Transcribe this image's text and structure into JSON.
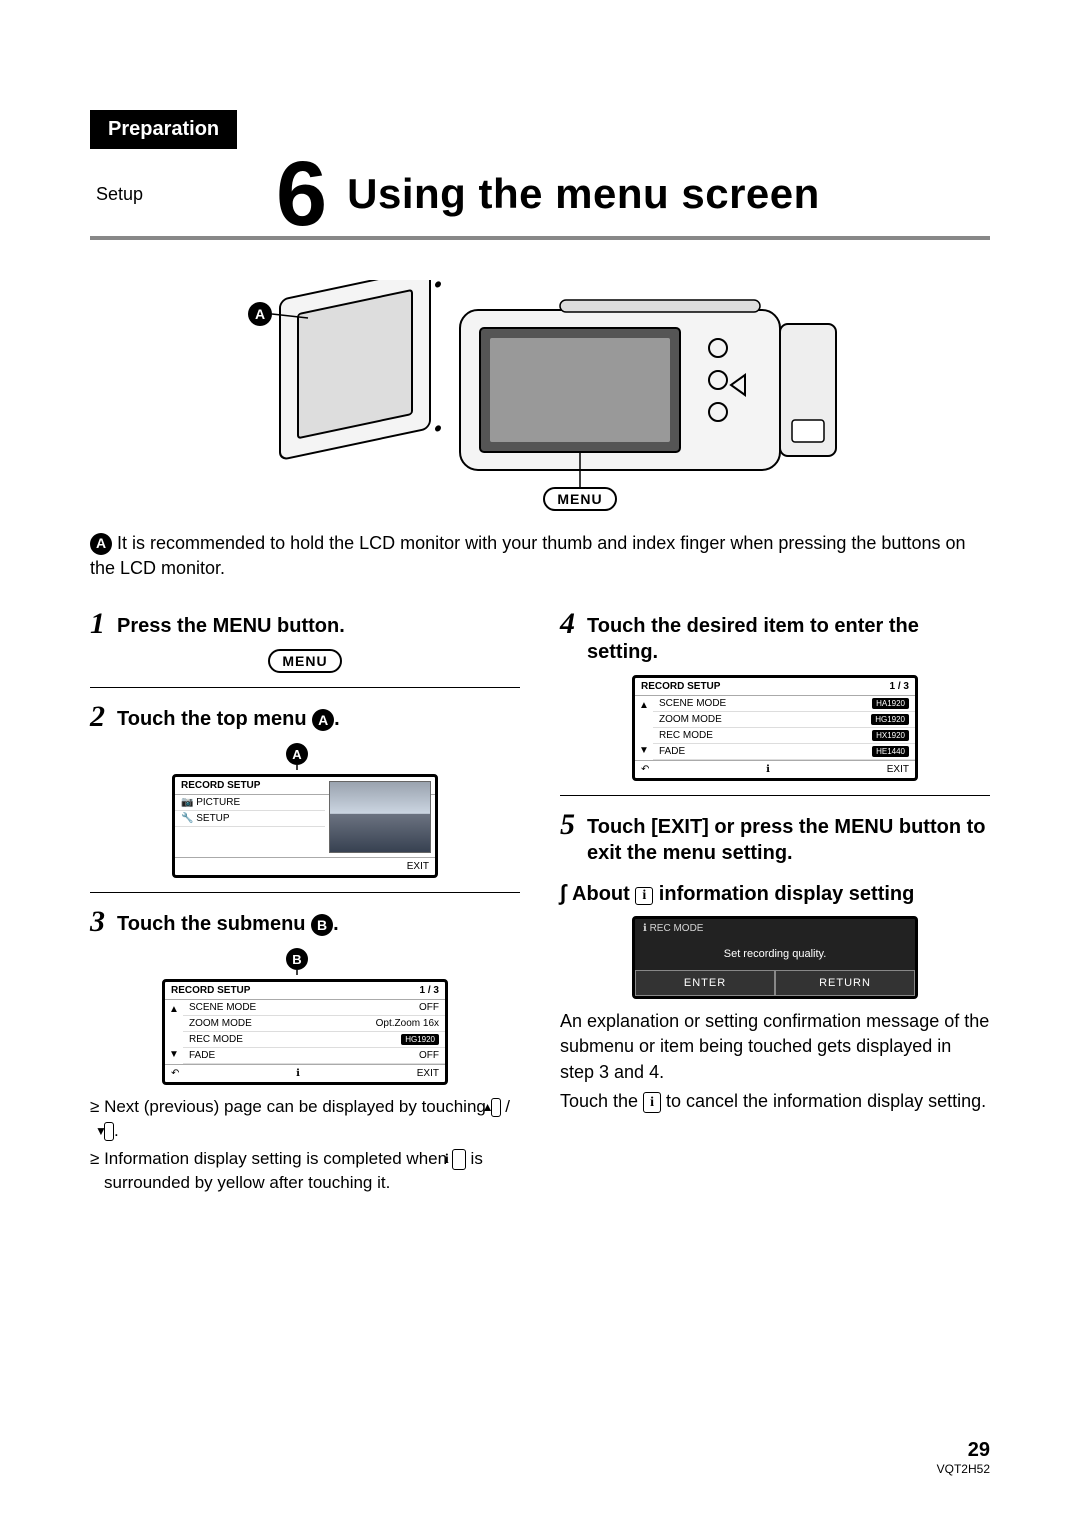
{
  "header": {
    "section": "Preparation",
    "subsection": "Setup",
    "number": "6",
    "title": "Using the menu screen"
  },
  "menu_label": "MENU",
  "callout": {
    "A": "A",
    "B": "B"
  },
  "intro_note": "It is recommended to hold the LCD monitor with your thumb and index finger when pressing the buttons on the LCD monitor.",
  "steps": {
    "s1": {
      "num": "1",
      "text": "Press the MENU button."
    },
    "s2": {
      "num": "2",
      "text_prefix": "Touch the top menu ",
      "text_suffix": "."
    },
    "s3": {
      "num": "3",
      "text_prefix": "Touch the submenu ",
      "text_suffix": "."
    },
    "s4": {
      "num": "4",
      "text": "Touch the desired item to enter the setting."
    },
    "s5": {
      "num": "5",
      "text": "Touch [EXIT] or press the MENU button to exit the menu setting."
    }
  },
  "lcd_top": {
    "title": "RECORD SETUP",
    "items": [
      "PICTURE",
      "SETUP"
    ],
    "exit": "EXIT"
  },
  "lcd_sub": {
    "title": "RECORD SETUP",
    "page": "1 / 3",
    "rows": [
      {
        "label": "SCENE MODE",
        "value": "OFF"
      },
      {
        "label": "ZOOM MODE",
        "value": "Opt.Zoom 16x"
      },
      {
        "label": "REC MODE",
        "value": "HG1920"
      },
      {
        "label": "FADE",
        "value": "OFF"
      }
    ],
    "exit": "EXIT"
  },
  "lcd_setting": {
    "title": "RECORD SETUP",
    "page": "1 / 3",
    "rows": [
      {
        "label": "SCENE MODE",
        "value": "HA1920"
      },
      {
        "label": "ZOOM MODE",
        "value": "HG1920"
      },
      {
        "label": "REC MODE",
        "value": "HX1920"
      },
      {
        "label": "FADE",
        "value": "HE1440"
      }
    ],
    "exit": "EXIT"
  },
  "bullets": {
    "b1_pre": "Next (previous) page can be displayed by touching ",
    "b1_mid": " / ",
    "b1_post": ".",
    "b2_pre": "Information display setting is completed when ",
    "b2_post": " is surrounded by yellow after touching it."
  },
  "arrows": {
    "up": "▲",
    "down": "▼"
  },
  "info_icon": "i",
  "about_heading_pre": "About ",
  "about_heading_post": " information display setting",
  "lcd_info": {
    "top": "REC MODE",
    "msg": "Set recording quality.",
    "enter": "ENTER",
    "return": "RETURN"
  },
  "about_para1": "An explanation or setting confirmation message of the submenu or item being touched gets displayed in step 3 and 4.",
  "about_para2_pre": "Touch the ",
  "about_para2_post": " to cancel the information display setting.",
  "footer": {
    "page": "29",
    "code": "VQT2H52"
  }
}
